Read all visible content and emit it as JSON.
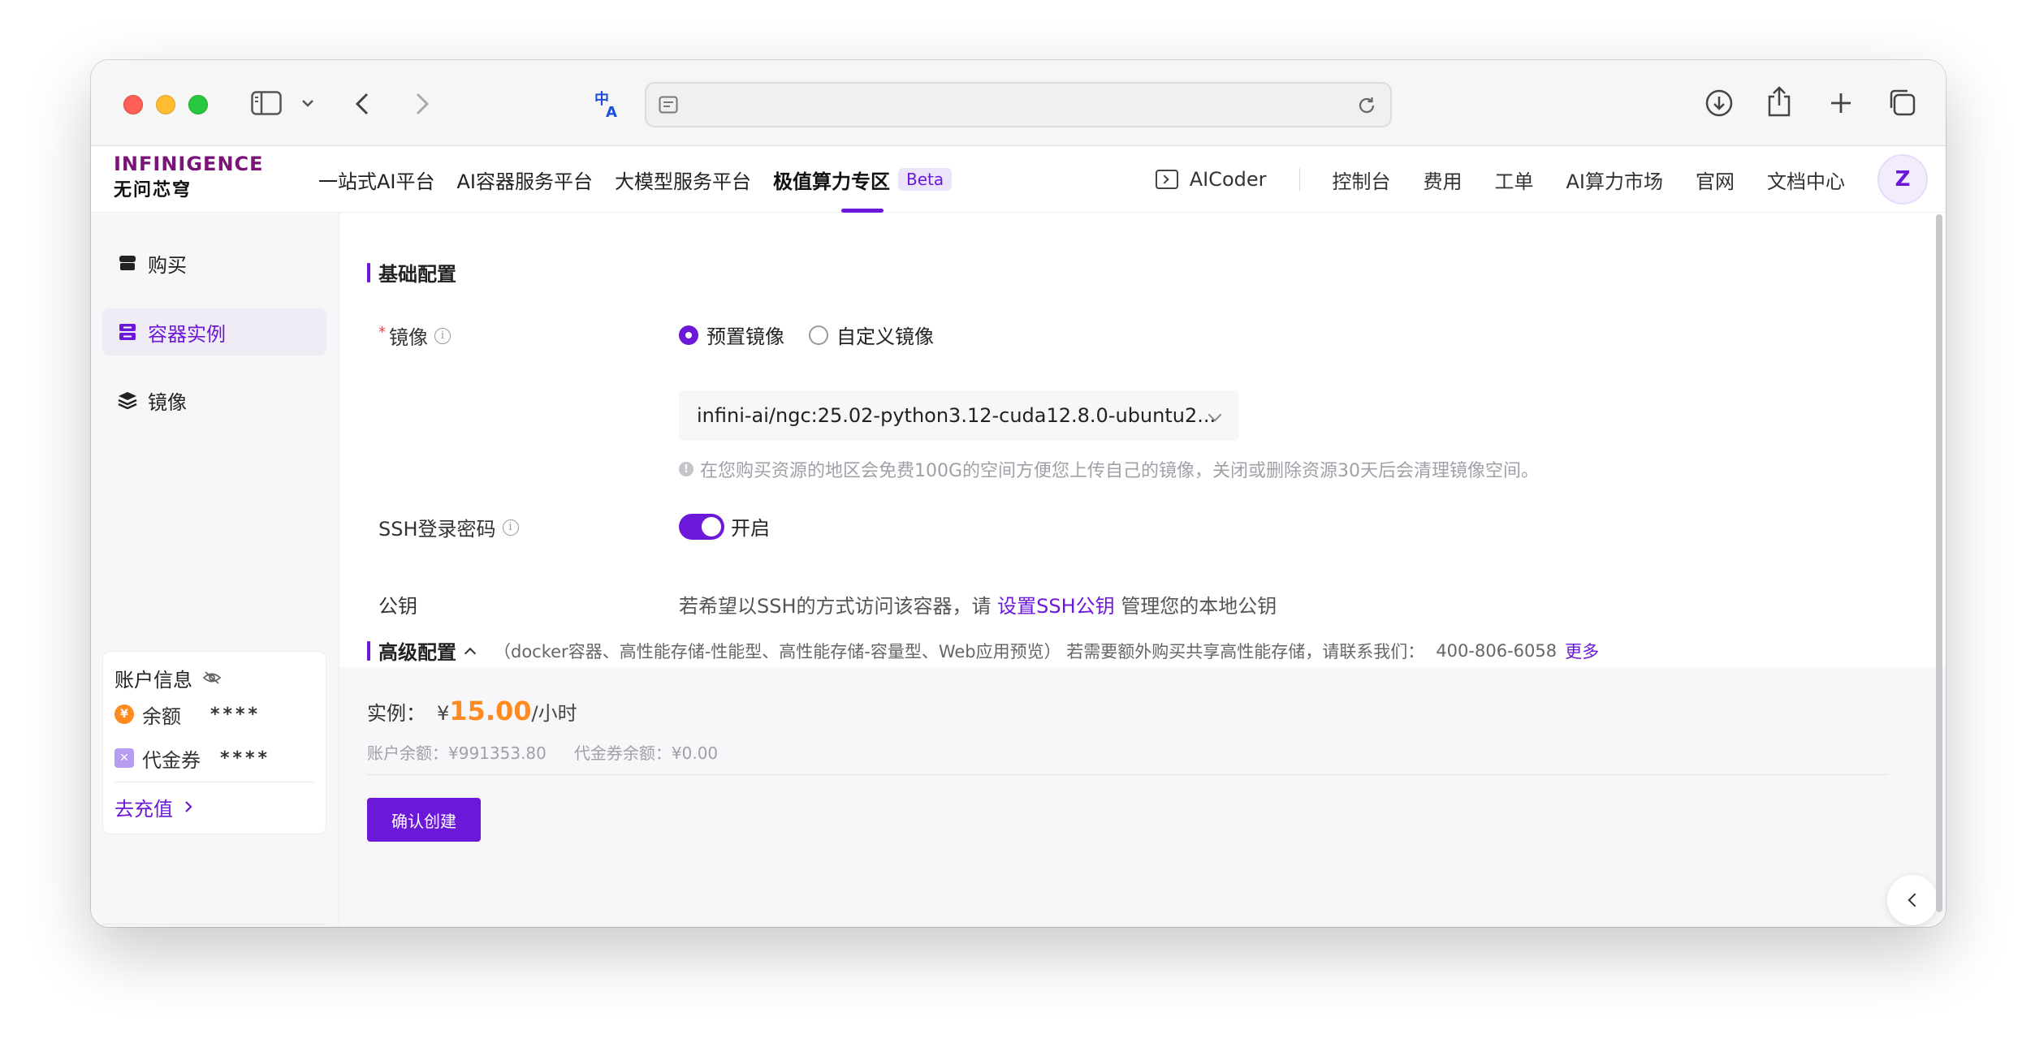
{
  "header": {
    "logo_top": "INFINIGENCE",
    "logo_bottom": "无问芯穹",
    "nav_left": [
      {
        "label": "一站式AI平台"
      },
      {
        "label": "AI容器服务平台"
      },
      {
        "label": "大模型服务平台"
      },
      {
        "label": "极值算力专区",
        "badge": "Beta",
        "active": true
      }
    ],
    "aicoder": "AICoder",
    "nav_right": [
      "控制台",
      "费用",
      "工单",
      "AI算力市场",
      "官网",
      "文档中心"
    ],
    "avatar_letter": "Z"
  },
  "sidebar": {
    "items": [
      {
        "label": "购买",
        "icon": "shop-icon"
      },
      {
        "label": "容器实例",
        "icon": "instance-icon",
        "active": true
      },
      {
        "label": "镜像",
        "icon": "layers-icon"
      }
    ],
    "account": {
      "title": "账户信息",
      "balance_label": "余额",
      "balance_value": "****",
      "voucher_label": "代金券",
      "voucher_value": "****",
      "recharge": "去充值"
    }
  },
  "main": {
    "basic_title": "基础配置",
    "image_label": "镜像",
    "image_required_mark": "*",
    "radio_preset": "预置镜像",
    "radio_custom": "自定义镜像",
    "image_select_value": "infini-ai/ngc:25.02-python3.12-cuda12.8.0-ubuntu2...",
    "image_hint": "在您购买资源的地区会免费100G的空间方便您上传自己的镜像，关闭或删除资源30天后会清理镜像空间。",
    "ssh_label": "SSH登录密码",
    "ssh_toggle_text": "开启",
    "pubkey_label": "公钥",
    "pubkey_text_before": "若希望以SSH的方式访问该容器，请",
    "pubkey_link": "设置SSH公钥",
    "pubkey_text_after": "管理您的本地公钥",
    "advanced_title": "高级配置",
    "advanced_desc": "（docker容器、高性能存储-性能型、高性能存储-容量型、Web应用预览）  若需要额外购买共享高性能存储，请联系我们：",
    "advanced_phone": "400-806-6058",
    "advanced_more": "更多",
    "price_label": "实例：",
    "price_currency": "¥",
    "price_amount": "15.00",
    "price_unit": "/小时",
    "account_balance": "账户余额：¥991353.80",
    "voucher_balance": "代金券余额：¥0.00",
    "confirm_button": "确认创建"
  },
  "colors": {
    "accent": "#6c18d8",
    "price": "#ff8a1f"
  }
}
